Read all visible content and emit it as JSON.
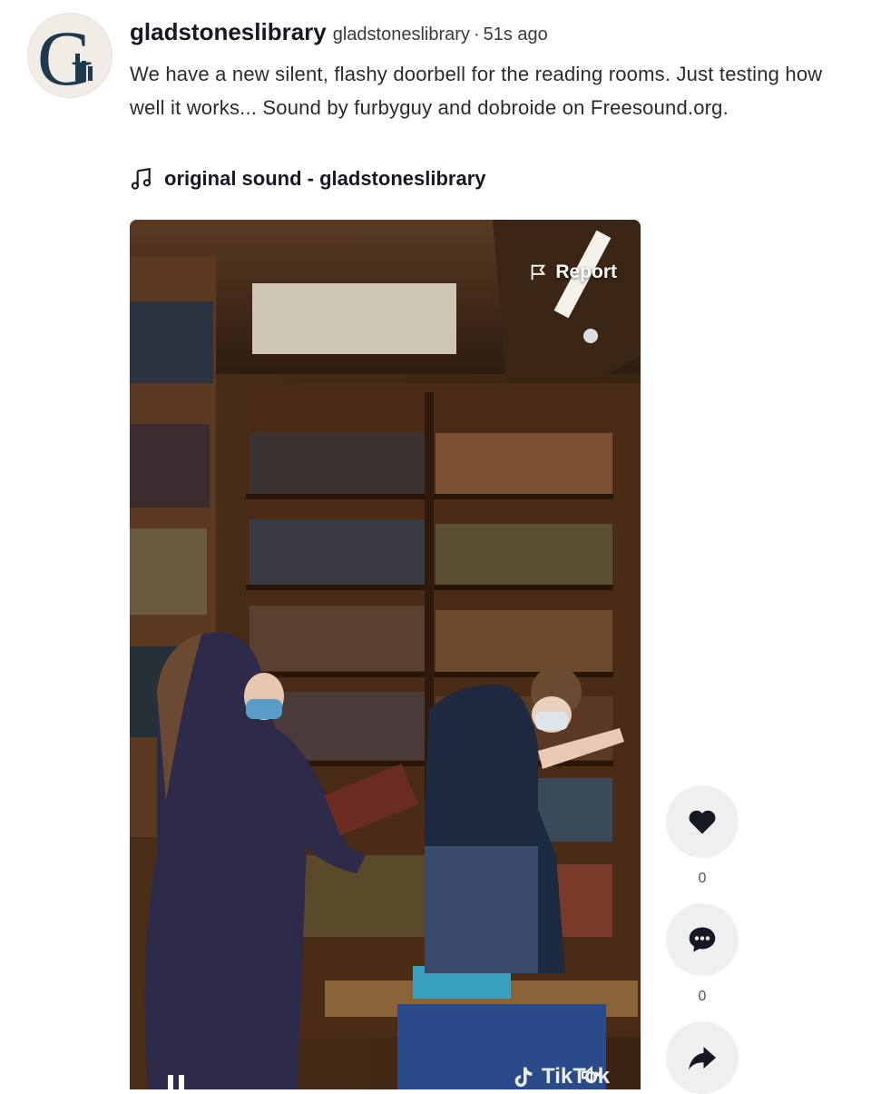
{
  "post": {
    "username": "gladstoneslibrary",
    "handle": "gladstoneslibrary",
    "separator": "·",
    "time_ago": "51s ago",
    "caption": "We have a new silent, flashy doorbell for the reading rooms. Just testing how well it works... Sound by furbyguy and dobroide on Freesound.org.",
    "music": "original sound - gladstoneslibrary"
  },
  "video": {
    "report_label": "Report",
    "watermark": "TikTok"
  },
  "actions": {
    "likes": "0",
    "comments": "0"
  },
  "colors": {
    "accent": "#161823",
    "action_bg": "#efefef",
    "avatar_logo": "#1f3a4d"
  },
  "icons": [
    "avatar-logo",
    "music-note-icon",
    "flag-icon",
    "pause-icon",
    "tiktok-logo-icon",
    "volume-icon",
    "heart-icon",
    "comment-icon",
    "share-icon"
  ]
}
